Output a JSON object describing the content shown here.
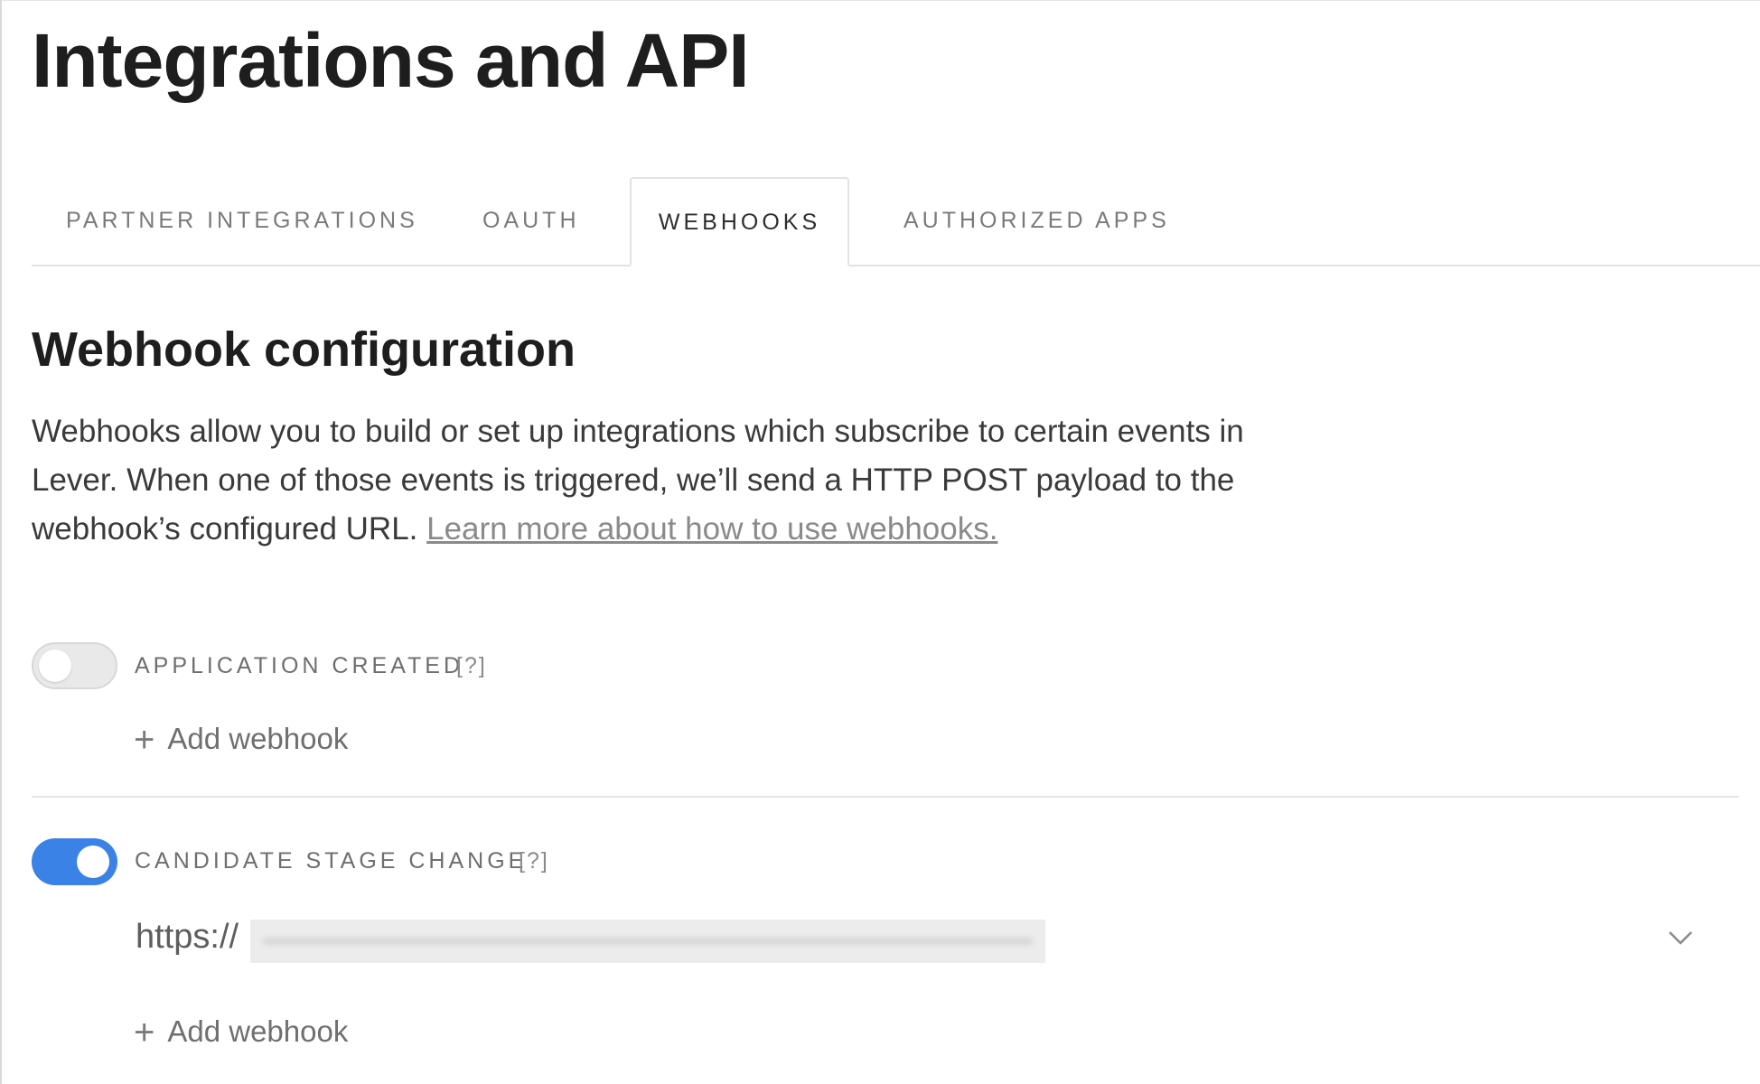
{
  "page": {
    "title": "Integrations and API"
  },
  "tabs": [
    {
      "label": "PARTNER INTEGRATIONS",
      "active": false
    },
    {
      "label": "OAUTH",
      "active": false
    },
    {
      "label": "WEBHOOKS",
      "active": true
    },
    {
      "label": "AUTHORIZED APPS",
      "active": false
    }
  ],
  "section": {
    "title": "Webhook configuration",
    "description": "Webhooks allow you to build or set up integrations which subscribe to certain events in Lever. When one of those events is triggered, we’ll send a HTTP POST payload to the webhook’s configured URL.",
    "link_text": "Learn more about how to use webhooks."
  },
  "events": [
    {
      "label": "APPLICATION CREATED",
      "help": "[?]",
      "enabled": false,
      "add_label": "Add webhook"
    },
    {
      "label": "CANDIDATE STAGE CHANGE",
      "help": "[?]",
      "enabled": true,
      "url_prefix": "https://",
      "add_label": "Add webhook"
    }
  ],
  "colors": {
    "toggle_on": "#3b82e6",
    "toggle_off": "#e9e9e9"
  },
  "icons": {
    "add": "plus-icon",
    "expand": "chevron-down-icon"
  }
}
